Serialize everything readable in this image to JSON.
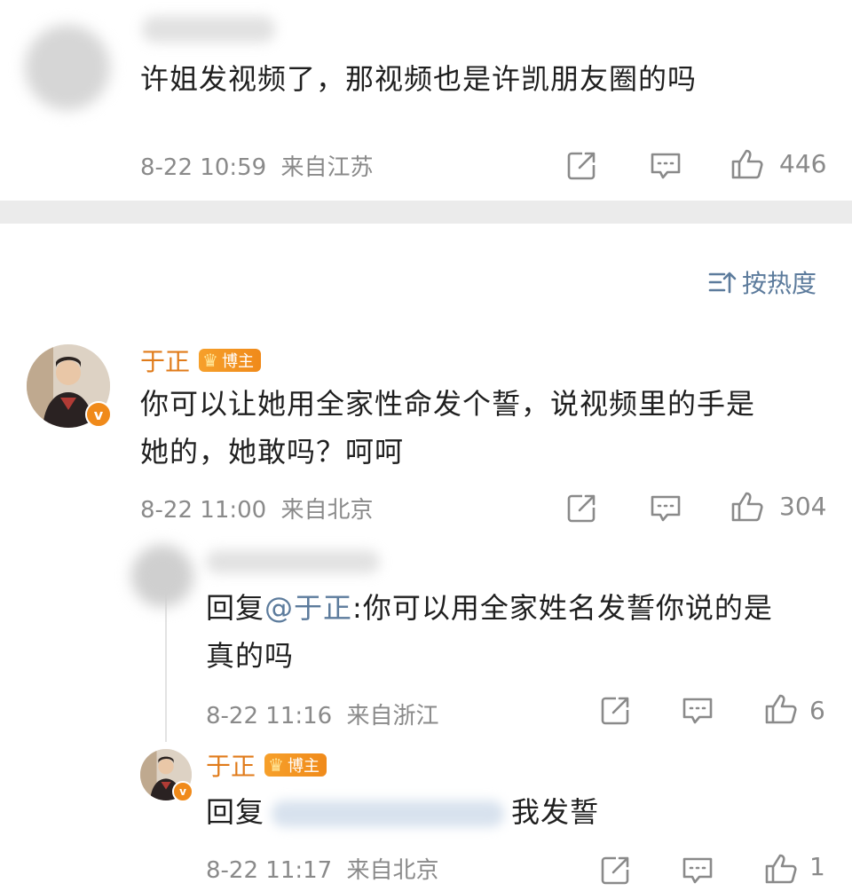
{
  "comments": [
    {
      "text": "许姐发视频了，那视频也是许凯朋友圈的吗",
      "time": "8-22 10:59",
      "location": "来自江苏",
      "likes": "446"
    },
    {
      "username": "于正",
      "badge": "博主",
      "text_line1": "你可以让她用全家性命发个誓，说视频里的手是",
      "text_line2": "她的，她敢吗？呵呵",
      "time": "8-22 11:00",
      "location": "来自北京",
      "likes": "304"
    }
  ],
  "sort_label": "按热度",
  "replies": [
    {
      "reply_prefix": "回复",
      "mention": "@于正",
      "text_line1": ":你可以用全家姓名发誓你说的是",
      "text_line2": "真的吗",
      "time": "8-22 11:16",
      "location": "来自浙江",
      "likes": "6"
    },
    {
      "username": "于正",
      "badge": "博主",
      "reply_prefix": "回复",
      "text_end": "我发誓",
      "time": "8-22 11:17",
      "location": "来自北京",
      "likes": "1"
    }
  ],
  "icons": {
    "share": "share-icon",
    "comment": "comment-icon",
    "like": "thumbs-up-icon",
    "sort": "sort-icon",
    "vip": "crown-icon",
    "verified": "verified-v-icon"
  },
  "colors": {
    "username": "#e07b1a",
    "link": "#5c7b9c",
    "meta": "#8a8a8a",
    "divider": "#ebebeb"
  },
  "verified_glyph": "v"
}
